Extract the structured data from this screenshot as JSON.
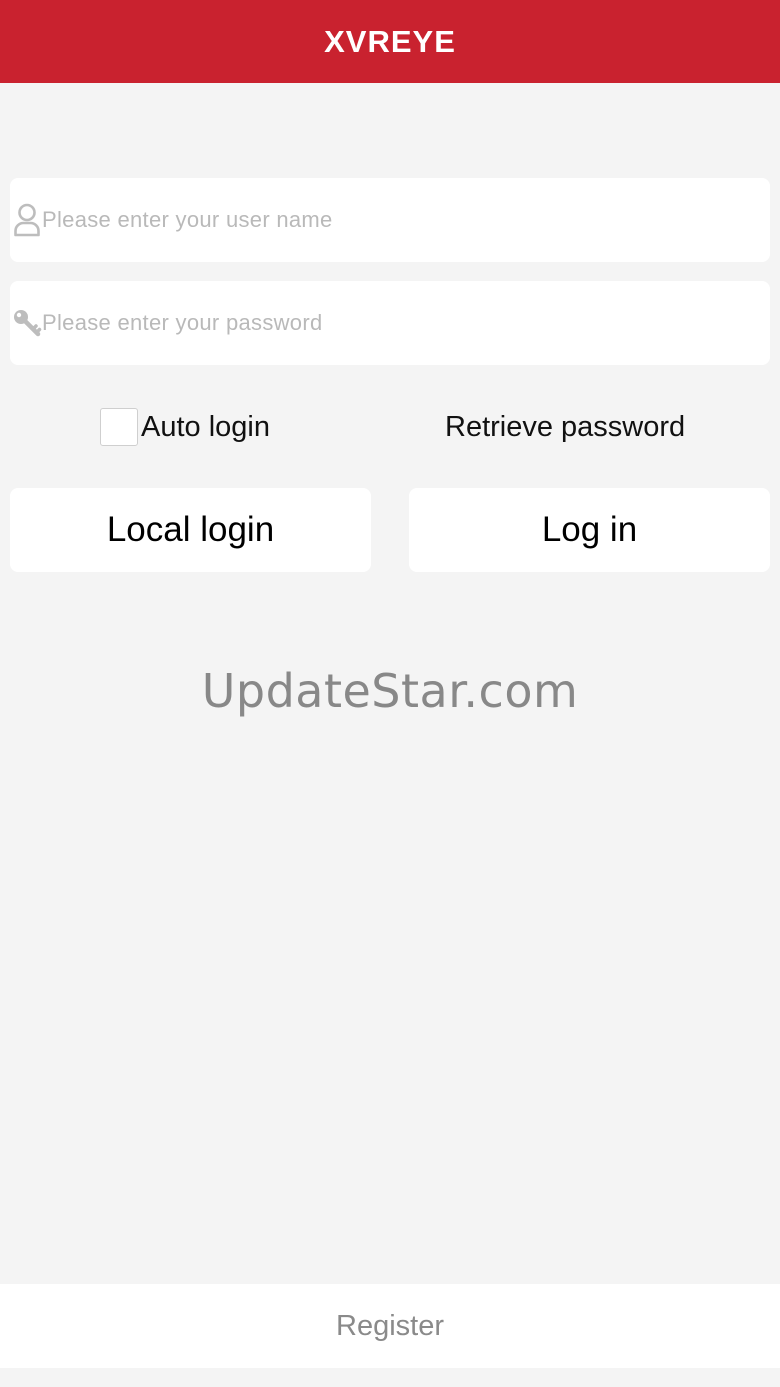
{
  "header": {
    "title": "XVREYE",
    "background_color": "#c9222f"
  },
  "login_form": {
    "username": {
      "icon": "user-icon",
      "value": "",
      "placeholder": "Please enter your user name"
    },
    "password": {
      "icon": "key-icon",
      "value": "",
      "placeholder": "Please enter your password"
    },
    "auto_login": {
      "label": "Auto login",
      "checked": false
    },
    "retrieve_password_label": "Retrieve password",
    "local_login_label": "Local login",
    "login_label": "Log in"
  },
  "watermark": "UpdateStar.com",
  "footer": {
    "register_label": "Register"
  }
}
